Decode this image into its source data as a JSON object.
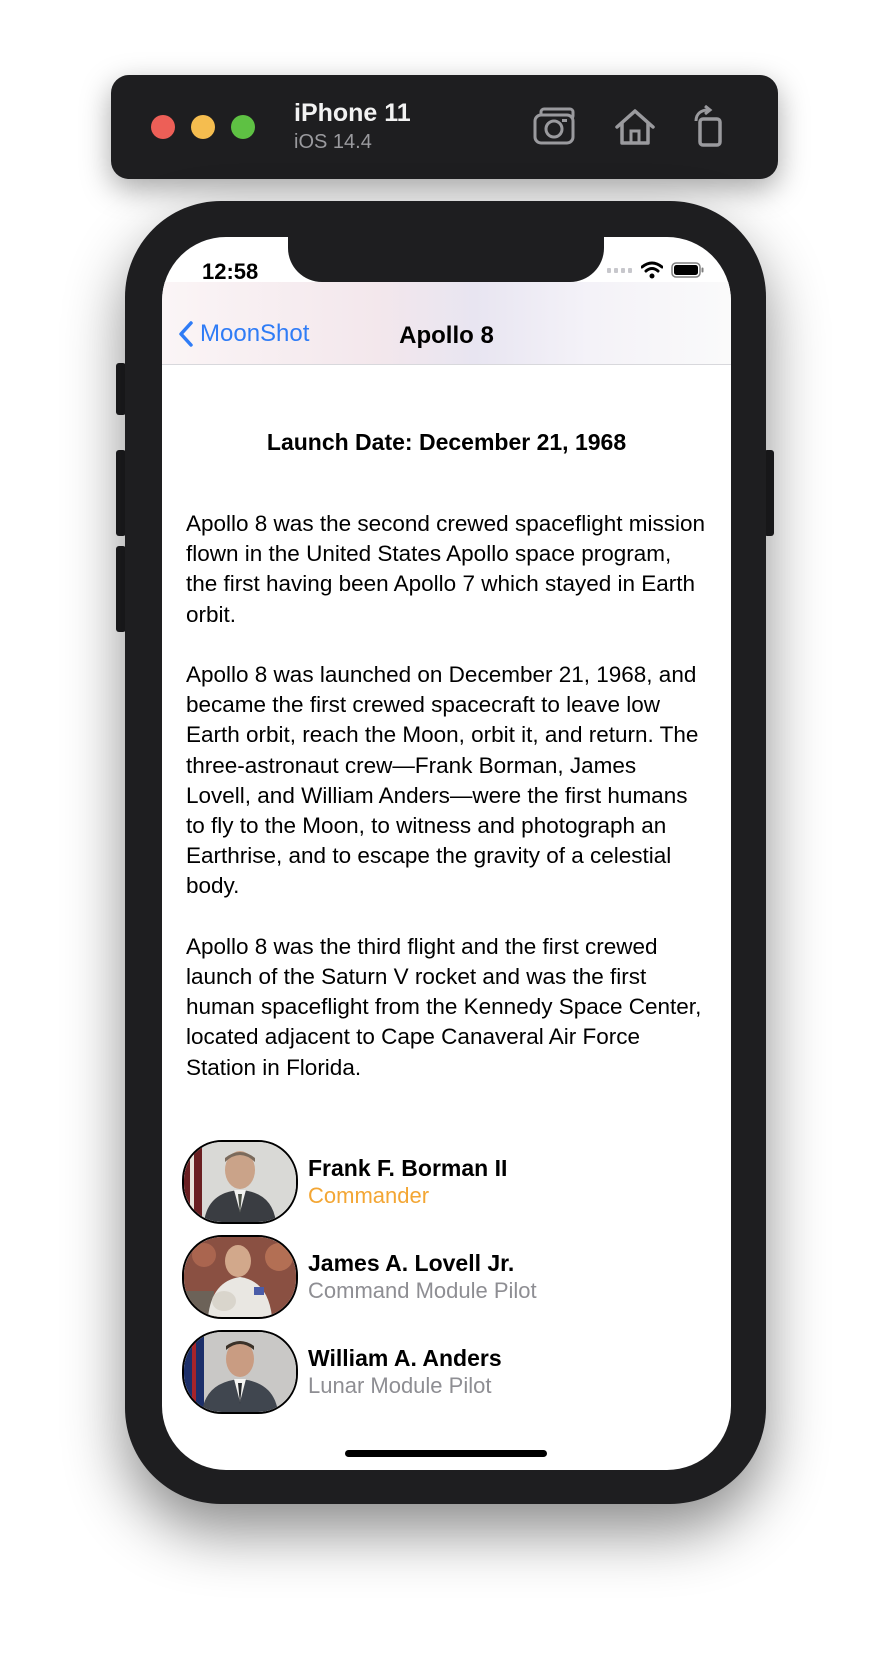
{
  "simulator": {
    "device_name": "iPhone 11",
    "os_version": "iOS 14.4",
    "icons": [
      "screenshot-icon",
      "home-icon",
      "rotate-icon"
    ]
  },
  "status_bar": {
    "time": "12:58"
  },
  "nav": {
    "back_label": "MoonShot",
    "title": "Apollo 8"
  },
  "mission": {
    "launch_date": "Launch Date: December 21, 1968",
    "description": "Apollo 8 was the second crewed spaceflight mission flown in the United States Apollo space program, the first having been Apollo 7 which stayed in Earth orbit.\n\nApollo 8 was launched on December 21, 1968, and became the first crewed spacecraft to leave low Earth orbit, reach the Moon, orbit it, and return. The three-astronaut crew—Frank Borman, James Lovell, and William Anders—were the first humans to fly to the Moon, to witness and photograph an Earthrise, and to escape the gravity of a celestial body.\n\nApollo 8 was the third flight and the first crewed launch of the Saturn V rocket and was the first human spaceflight from the Kennedy Space Center, located adjacent to Cape Canaveral Air Force Station in Florida."
  },
  "crew": [
    {
      "name": "Frank F. Borman II",
      "role": "Commander"
    },
    {
      "name": "James A. Lovell Jr.",
      "role": "Command Module Pilot"
    },
    {
      "name": "William A. Anders",
      "role": "Lunar Module Pilot"
    }
  ],
  "colors": {
    "link_blue": "#2f7cf6",
    "commander_orange": "#f3a634",
    "role_gray": "#8e8e93"
  }
}
